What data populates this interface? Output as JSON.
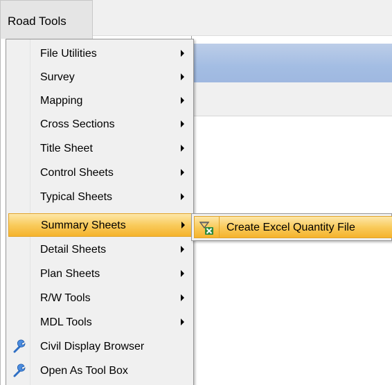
{
  "menubar": {
    "title": "Road Tools"
  },
  "menu": {
    "items": [
      {
        "label": "File Utilities",
        "has_submenu": true
      },
      {
        "label": "Survey",
        "has_submenu": true
      },
      {
        "label": "Mapping",
        "has_submenu": true
      },
      {
        "label": "Cross Sections",
        "has_submenu": true
      },
      {
        "label": "Title Sheet",
        "has_submenu": true
      },
      {
        "label": "Control Sheets",
        "has_submenu": true
      },
      {
        "label": "Typical Sheets",
        "has_submenu": true
      },
      {
        "label": "Summary Sheets",
        "has_submenu": true,
        "highlighted": true
      },
      {
        "label": "Detail Sheets",
        "has_submenu": true
      },
      {
        "label": "Plan Sheets",
        "has_submenu": true
      },
      {
        "label": "R/W Tools",
        "has_submenu": true
      },
      {
        "label": "MDL Tools",
        "has_submenu": true
      },
      {
        "label": "Civil Display Browser",
        "icon": "wrench-icon"
      },
      {
        "label": "Open As Tool Box",
        "icon": "wrench-icon"
      }
    ]
  },
  "submenu": {
    "items": [
      {
        "label": "Create Excel Quantity File",
        "icon": "excel-quantity-icon",
        "highlighted": true
      }
    ]
  },
  "colors": {
    "highlight_top": "#fde7a9",
    "highlight_bottom": "#f5b32c",
    "highlight_border": "#e1a32a",
    "menu_bg": "#f0f0f0",
    "titlebar_blue": "#a3bde3"
  }
}
